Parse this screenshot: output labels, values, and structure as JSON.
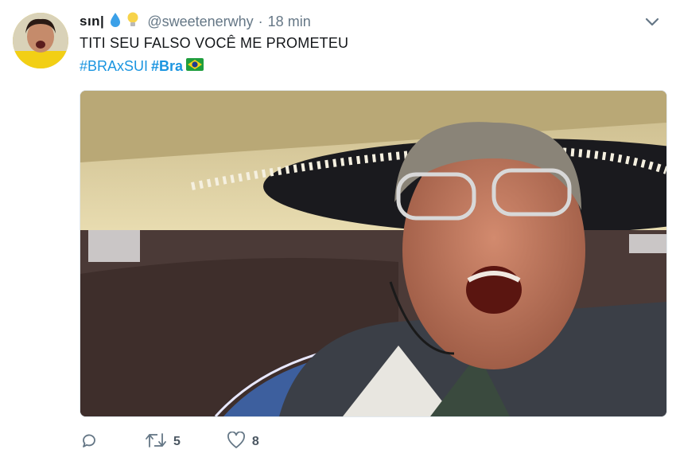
{
  "tweet": {
    "user": {
      "display_name": "sın|",
      "handle": "@sweetenerwhy",
      "separator": "·",
      "time": "18 min"
    },
    "text": "TITI SEU FALSO VOCÊ ME PROMETEU",
    "hashtags": [
      "#BRAxSUI",
      "#Bra"
    ],
    "actions": {
      "retweets": "5",
      "likes": "8"
    }
  },
  "icons": {
    "emoji_1": "droplet-icon",
    "emoji_2": "lightbulb-icon",
    "flag": "brazil-flag-icon",
    "menu": "chevron-down-icon",
    "reply": "reply-icon",
    "retweet": "retweet-icon",
    "like": "heart-icon"
  },
  "colors": {
    "link": "#1b95e0",
    "meta": "#657786"
  }
}
